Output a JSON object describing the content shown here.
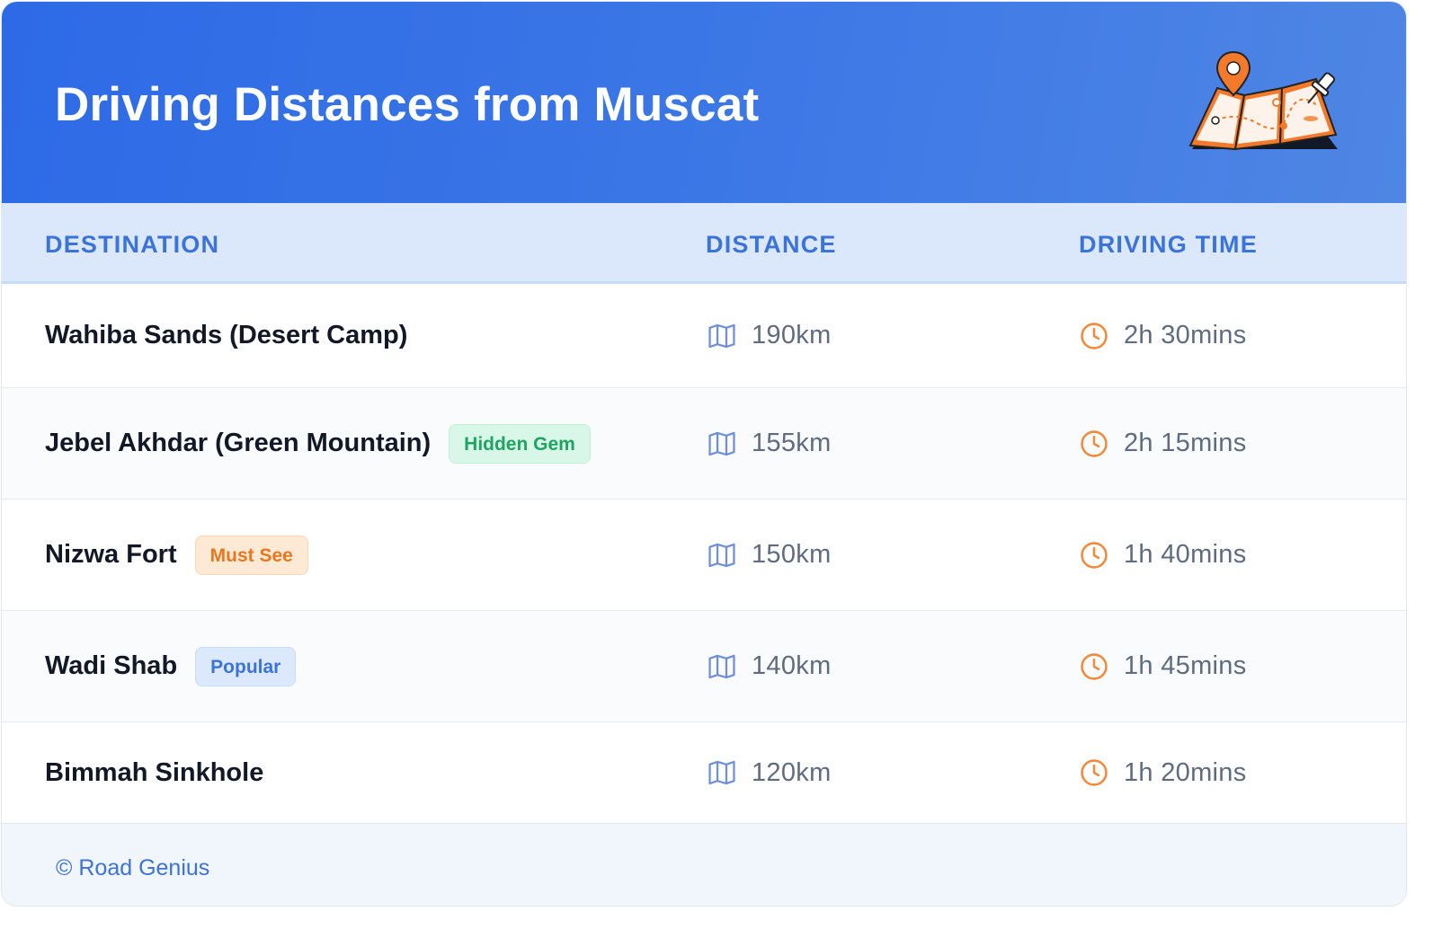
{
  "header": {
    "title": "Driving Distances from Muscat",
    "illustration_icon": "folded-map-with-pins-icon"
  },
  "table": {
    "columns": [
      "DESTINATION",
      "DISTANCE",
      "DRIVING TIME"
    ],
    "rows": [
      {
        "destination": "Wahiba Sands (Desert Camp)",
        "badge": "",
        "distance": "190km",
        "time": "2h 30mins"
      },
      {
        "destination": "Jebel Akhdar (Green Mountain)",
        "badge": "Hidden Gem",
        "distance": "155km",
        "time": "2h 15mins"
      },
      {
        "destination": "Nizwa Fort",
        "badge": "Must See",
        "distance": "150km",
        "time": "1h 40mins"
      },
      {
        "destination": "Wadi Shab",
        "badge": "Popular",
        "distance": "140km",
        "time": "1h 45mins"
      },
      {
        "destination": "Bimmah Sinkhole",
        "badge": "",
        "distance": "120km",
        "time": "1h 20mins"
      }
    ]
  },
  "icons": {
    "distance": "map-icon",
    "time": "clock-icon"
  },
  "colors": {
    "header_gradient_start": "#2d6ae6",
    "header_gradient_end": "#4f86e4",
    "accent_blue": "#3b73d9",
    "clock_orange": "#f08a3c",
    "badge_green": "#1fa462",
    "badge_orange": "#e8771f"
  },
  "footer": {
    "text": "© Road Genius"
  }
}
